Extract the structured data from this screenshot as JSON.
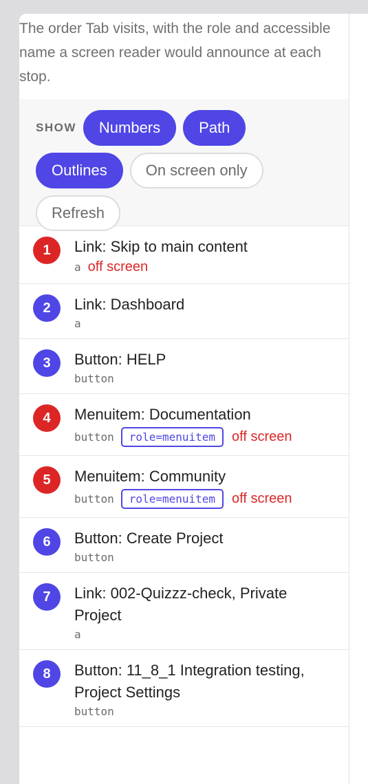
{
  "description": "The order Tab visits, with the role and accessible name a screen reader would announce at each stop.",
  "controls": {
    "show_label": "SHOW",
    "buttons": [
      {
        "label": "Numbers",
        "active": true
      },
      {
        "label": "Path",
        "active": true
      },
      {
        "label": "Outlines",
        "active": true
      },
      {
        "label": "On screen only",
        "active": false
      },
      {
        "label": "Refresh",
        "active": false
      }
    ]
  },
  "colors": {
    "accent": "#4f46e5",
    "warning": "#dc2626"
  },
  "items": [
    {
      "num": "1",
      "name": "Link: Skip to main content",
      "tag": "a",
      "role": "",
      "status": "off screen",
      "badge": "red"
    },
    {
      "num": "2",
      "name": "Link: Dashboard",
      "tag": "a",
      "role": "",
      "status": "",
      "badge": "blue"
    },
    {
      "num": "3",
      "name": "Button: HELP",
      "tag": "button",
      "role": "",
      "status": "",
      "badge": "blue"
    },
    {
      "num": "4",
      "name": "Menuitem: Documentation",
      "tag": "button",
      "role": "role=menuitem",
      "status": "off screen",
      "badge": "red"
    },
    {
      "num": "5",
      "name": "Menuitem: Community",
      "tag": "button",
      "role": "role=menuitem",
      "status": "off screen",
      "badge": "red"
    },
    {
      "num": "6",
      "name": "Button: Create Project",
      "tag": "button",
      "role": "",
      "status": "",
      "badge": "blue"
    },
    {
      "num": "7",
      "name": "Link: 002-Quizzz-check, Private Project",
      "tag": "a",
      "role": "",
      "status": "",
      "badge": "blue"
    },
    {
      "num": "8",
      "name": "Button: 11_8_1 Integration testing, Project Settings",
      "tag": "button",
      "role": "",
      "status": "",
      "badge": "blue"
    }
  ]
}
